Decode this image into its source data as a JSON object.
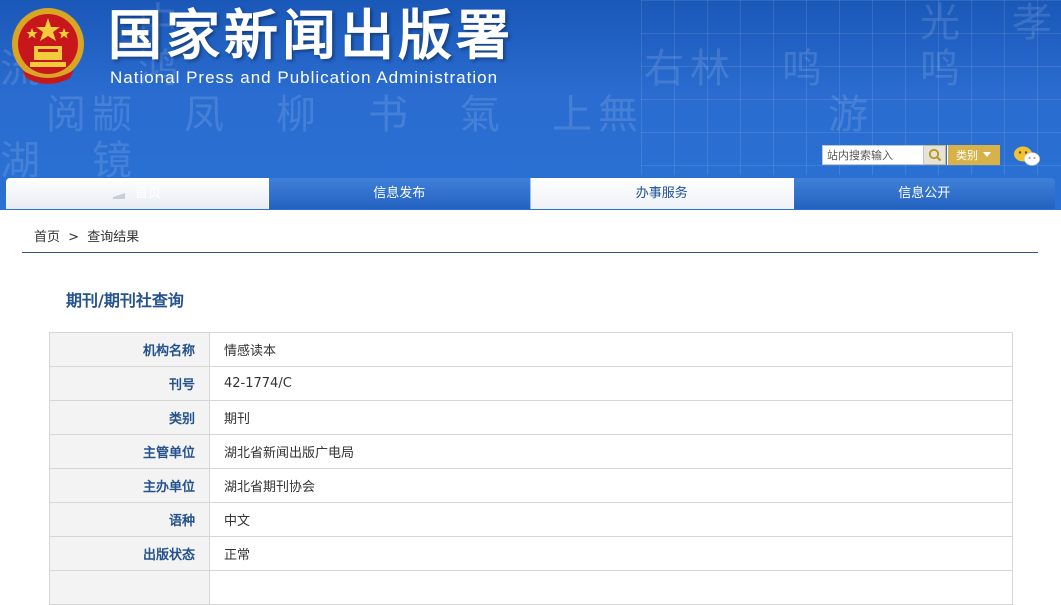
{
  "header": {
    "title_cn": "国家新闻出版署",
    "title_en": "National Press and Publication Administration",
    "search_placeholder": "站内搜索输入",
    "search_type_label": "类别"
  },
  "nav": {
    "items": [
      {
        "label": "首页"
      },
      {
        "label": "信息发布"
      },
      {
        "label": "办事服务"
      },
      {
        "label": "信息公开"
      }
    ]
  },
  "breadcrumb": {
    "home": "首页",
    "sep": ">",
    "current": "查询结果"
  },
  "page": {
    "title": "期刊/期刊社查询"
  },
  "details": [
    {
      "label": "机构名称",
      "value": "情感读本"
    },
    {
      "label": "刊号",
      "value": "42-1774/C"
    },
    {
      "label": "类别",
      "value": "期刊"
    },
    {
      "label": "主管单位",
      "value": "湖北省新闻出版广电局"
    },
    {
      "label": "主办单位",
      "value": "湖北省期刊协会"
    },
    {
      "label": "语种",
      "value": "中文"
    },
    {
      "label": "出版状态",
      "value": "正常"
    },
    {
      "label": "",
      "value": ""
    }
  ],
  "colors": {
    "header_blue": "#2a6cd0",
    "label_blue": "#26528c",
    "accent_gold": "#d7b24a"
  },
  "icons": [
    "national-emblem-icon",
    "search-icon",
    "dropdown-caret-icon",
    "wechat-icon",
    "home-icon"
  ]
}
